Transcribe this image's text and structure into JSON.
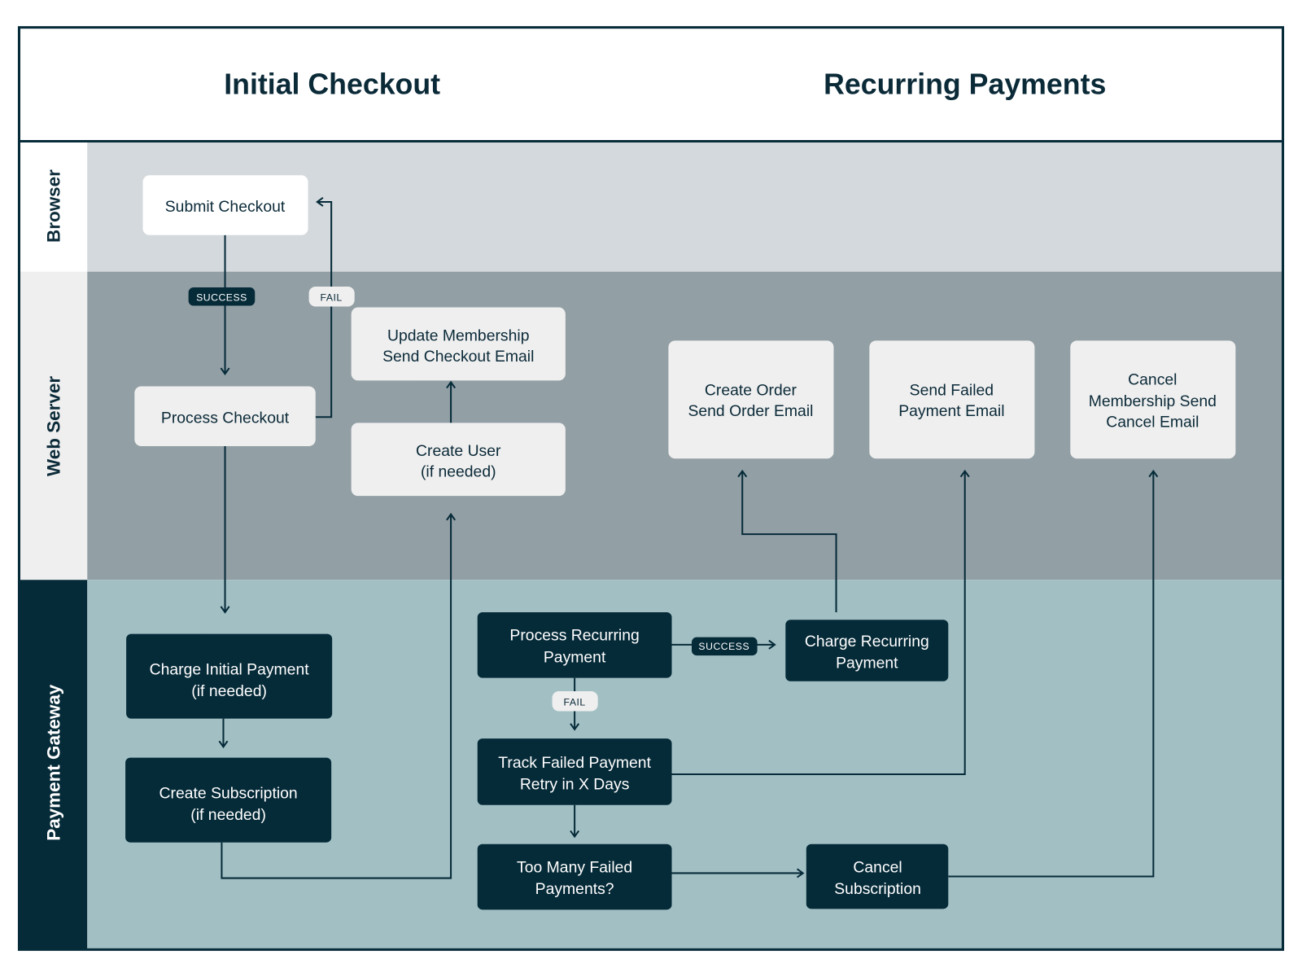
{
  "header": {
    "left_title": "Initial Checkout",
    "right_title": "Recurring Payments"
  },
  "lanes": {
    "browser": "Browser",
    "web_server": "Web Server",
    "payment_gateway": "Payment Gateway"
  },
  "colors": {
    "dark": "#052a38",
    "browser_lane": "#d4d9dd",
    "web_server_lane": "#929fa5",
    "gateway_lane": "#a2c0c4",
    "light_box": "#efefef"
  },
  "nodes": {
    "submit_checkout": [
      "Submit Checkout"
    ],
    "process_checkout": [
      "Process Checkout"
    ],
    "update_membership": [
      "Update Membership",
      "Send Checkout Email"
    ],
    "create_user": [
      "Create User",
      "(if needed)"
    ],
    "create_order": [
      "Create Order",
      "Send Order Email"
    ],
    "send_failed_payment_email": [
      "Send Failed",
      "Payment Email"
    ],
    "cancel_membership": [
      "Cancel",
      "Membership Send",
      "Cancel Email"
    ],
    "charge_initial_payment": [
      "Charge Initial Payment",
      "(if needed)"
    ],
    "create_subscription": [
      "Create Subscription",
      "(if needed)"
    ],
    "process_recurring_payment": [
      "Process Recurring",
      "Payment"
    ],
    "charge_recurring_payment": [
      "Charge Recurring",
      "Payment"
    ],
    "track_failed_payment": [
      "Track Failed Payment",
      "Retry in X Days"
    ],
    "too_many_failed": [
      "Too Many Failed",
      "Payments?"
    ],
    "cancel_subscription": [
      "Cancel",
      "Subscription"
    ]
  },
  "badges": {
    "checkout_success": "SUCCESS",
    "checkout_fail": "FAIL",
    "recurring_success": "SUCCESS",
    "recurring_fail": "FAIL"
  }
}
